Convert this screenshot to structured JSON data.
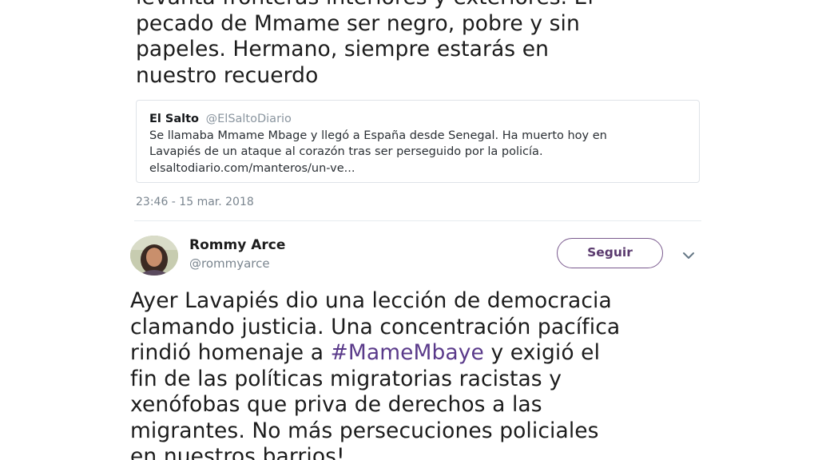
{
  "tweet1": {
    "lines": [
      "levanta fronteras interiores y exteriores. El",
      "pecado de Mmame ser negro, pobre y sin",
      "papeles. Hermano, siempre estarás en",
      "nuestro recuerdo"
    ]
  },
  "quoted_tweet": {
    "name": "El Salto",
    "handle": "@ElSaltoDiario",
    "lines": [
      "Se llamaba Mmame Mbage y llegó a España desde Senegal. Ha muerto hoy en",
      "Lavapiés de un ataque al corazón tras ser perseguido por la policía.",
      "elsaltodiario.com/manteros/un-ve..."
    ]
  },
  "tweet1_timestamp": "23:46 - 15 mar. 2018",
  "tweet2": {
    "author_name": "Rommy Arce",
    "author_handle": "@rommyarce",
    "follow_label": "Seguir",
    "icons": {
      "avatar": "user-avatar-photo",
      "more": "chevron-down-icon"
    },
    "colors": {
      "follow_border": "#7a5a8e",
      "hashtag": "#5a3a8a"
    },
    "lines": {
      "l1": "Ayer Lavapiés dio una lección de democracia",
      "l2": "clamando justicia. Una concentración pacífica",
      "l3_before": "rindió homenaje a ",
      "l3_hashtag": "#MameMbaye",
      "l3_after": " y exigió el",
      "l4": "fin de las políticas migratorias racistas y",
      "l5": "xenófobas que priva de derechos a las",
      "l6": "migrantes. No más persecuciones policiales",
      "l7": "en nuestros barrios!"
    }
  }
}
